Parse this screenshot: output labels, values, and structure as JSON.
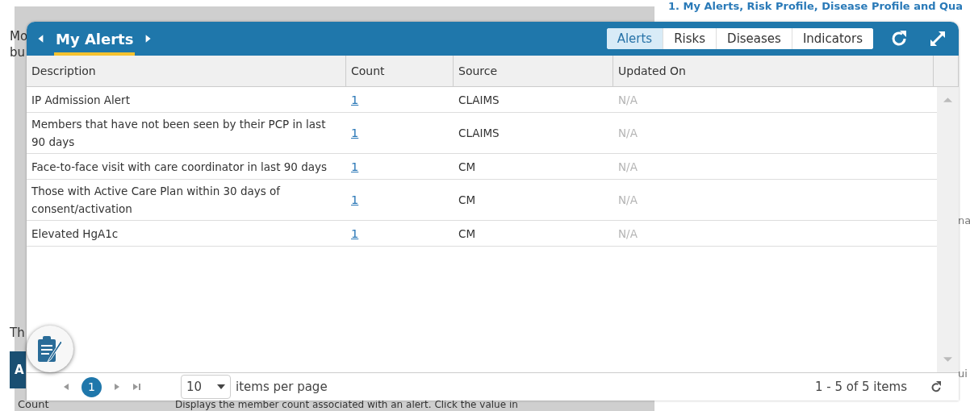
{
  "background": {
    "link": "1. My Alerts, Risk Profile, Disease Profile and Qua",
    "left_fragments": [
      "Mo",
      "bu",
      "Th"
    ],
    "side_tab": "A",
    "column_label": "Count",
    "sentence": "Displays the member count associated with an alert. Click the value in",
    "right_fragments": [
      "na",
      "ui"
    ]
  },
  "widget": {
    "title": "My Alerts",
    "tabs": [
      {
        "label": "Alerts",
        "selected": true
      },
      {
        "label": "Risks",
        "selected": false
      },
      {
        "label": "Diseases",
        "selected": false
      },
      {
        "label": "Indicators",
        "selected": false
      }
    ],
    "table": {
      "columns": [
        "Description",
        "Count",
        "Source",
        "Updated On"
      ],
      "rows": [
        {
          "description": "IP Admission Alert",
          "count": "1",
          "source": "CLAIMS",
          "updated_on": "N/A"
        },
        {
          "description": "Members that have not been seen by their PCP in last 90 days",
          "count": "1",
          "source": "CLAIMS",
          "updated_on": "N/A"
        },
        {
          "description": "Face-to-face visit with care coordinator in last 90 days",
          "count": "1",
          "source": "CM",
          "updated_on": "N/A"
        },
        {
          "description": "Those with Active Care Plan within 30 days of consent/activation",
          "count": "1",
          "source": "CM",
          "updated_on": "N/A"
        },
        {
          "description": "Elevated HgA1c",
          "count": "1",
          "source": "CM",
          "updated_on": "N/A"
        }
      ]
    },
    "pager": {
      "current_page": "1",
      "page_size": "10",
      "page_size_label": "items per page",
      "summary": "1 - 5 of 5 items"
    }
  }
}
